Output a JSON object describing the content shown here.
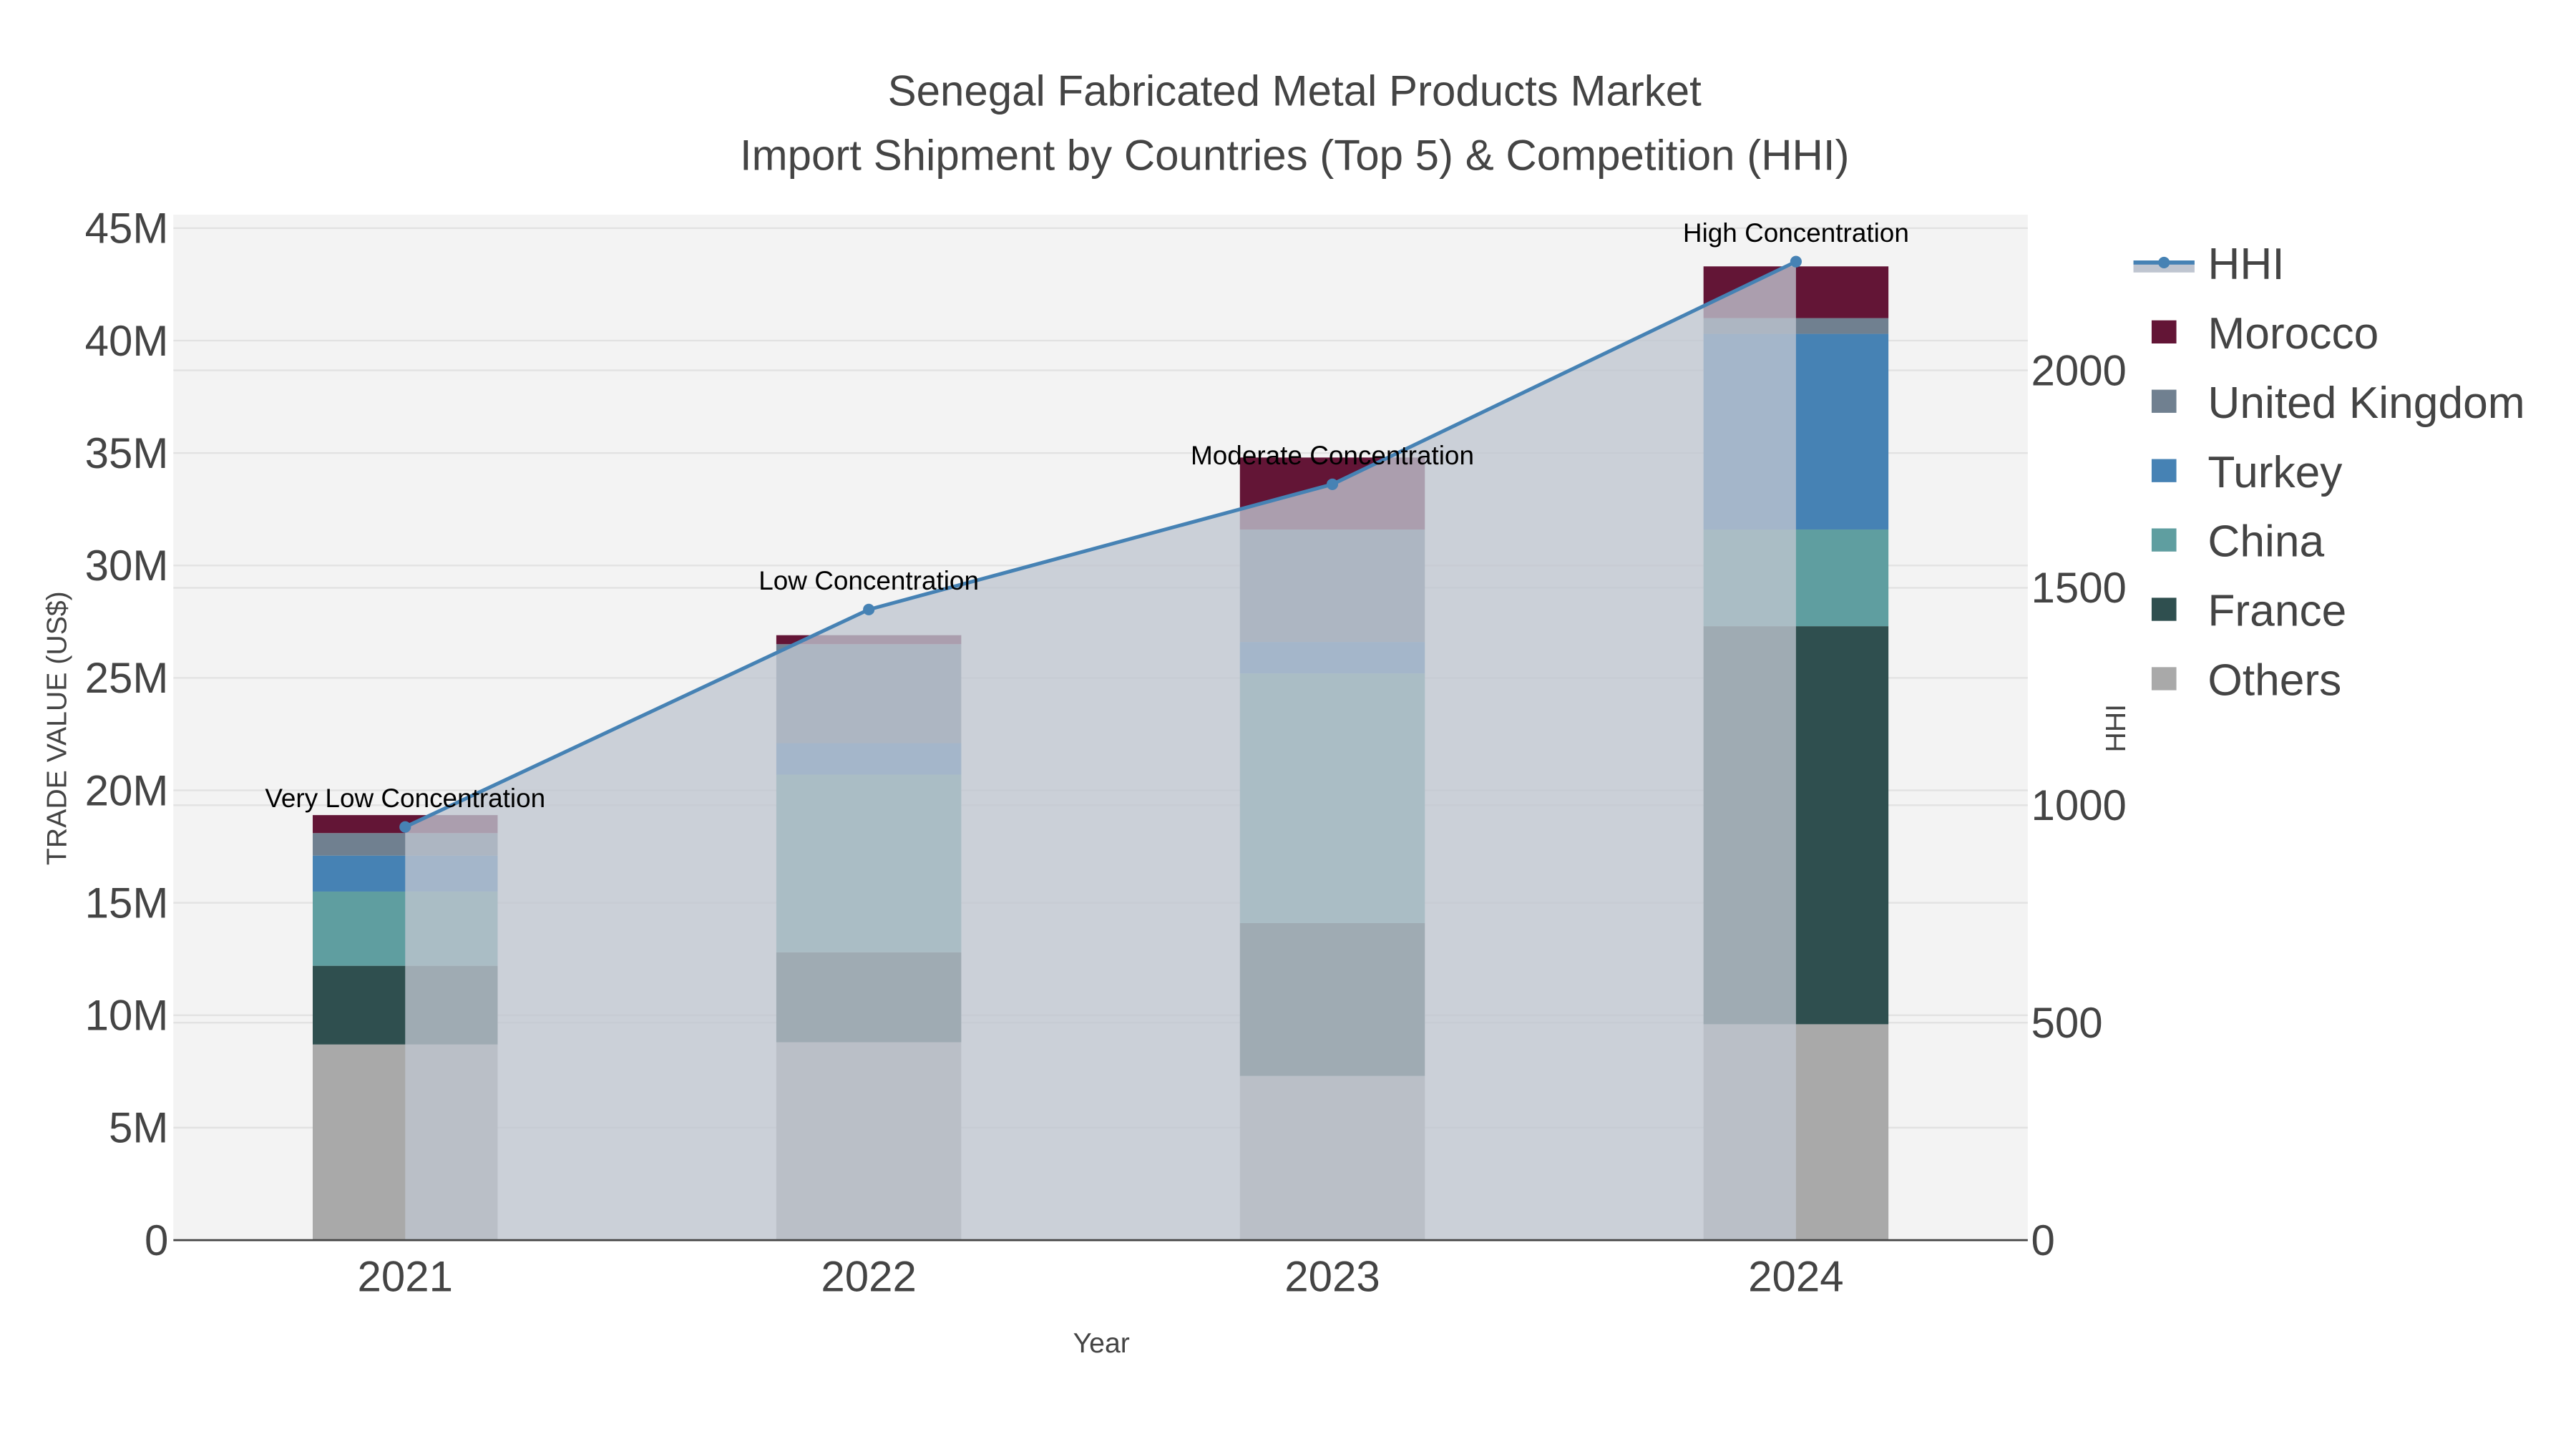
{
  "chart_data": {
    "type": "bar",
    "title_line1": "Senegal Fabricated Metal Products Market",
    "title_line2": "Import Shipment by Countries (Top 5) & Competition (HHI)",
    "xlabel": "Year",
    "ylabel": "TRADE VALUE (US$)",
    "y2label": "HHI",
    "categories": [
      "2021",
      "2022",
      "2023",
      "2024"
    ],
    "ylim": [
      0,
      45.6
    ],
    "y_unit": "M US$",
    "y_ticks": [
      0,
      5,
      10,
      15,
      20,
      25,
      30,
      35,
      40,
      45
    ],
    "y_tick_labels": [
      "0",
      "5M",
      "10M",
      "15M",
      "20M",
      "25M",
      "30M",
      "35M",
      "40M",
      "45M"
    ],
    "y2lim": [
      0,
      2358
    ],
    "y2_ticks": [
      0,
      500,
      1000,
      1500,
      2000
    ],
    "y2_tick_labels": [
      "0",
      "500",
      "1000",
      "1500",
      "2000"
    ],
    "grid": true,
    "legend_position": "right",
    "stacked": true,
    "series": [
      {
        "name": "Others",
        "color": "#A9A9A9",
        "values": [
          8.7,
          8.8,
          7.3,
          9.6
        ]
      },
      {
        "name": "France",
        "color": "#2F4F4F",
        "values": [
          3.5,
          4.0,
          6.8,
          17.7
        ]
      },
      {
        "name": "China",
        "color": "#5F9EA0",
        "values": [
          3.3,
          7.9,
          11.1,
          4.3
        ]
      },
      {
        "name": "Turkey",
        "color": "#4682B4",
        "values": [
          1.6,
          1.4,
          1.4,
          8.7
        ]
      },
      {
        "name": "United Kingdom",
        "color": "#708090",
        "values": [
          1.0,
          4.4,
          5.0,
          0.7
        ]
      },
      {
        "name": "Morocco",
        "color": "#631536",
        "values": [
          0.8,
          0.4,
          3.2,
          2.3
        ]
      }
    ],
    "line": {
      "name": "HHI",
      "color": "#4682B4",
      "fill_color": "#BFC5D0",
      "values": [
        950,
        1450,
        1738,
        2250
      ],
      "annotations": [
        "Very Low Concentration",
        "Low Concentration",
        "Moderate Concentration",
        "High Concentration"
      ]
    },
    "legend_order": [
      "HHI",
      "Morocco",
      "United Kingdom",
      "Turkey",
      "China",
      "France",
      "Others"
    ]
  }
}
